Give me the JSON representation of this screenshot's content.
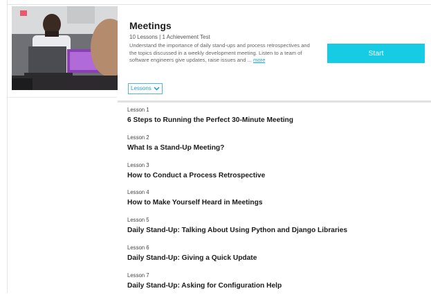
{
  "course": {
    "title": "Meetings",
    "meta": "10 Lessons | 1 Achievement Test",
    "description": "Understand the importance of daily stand-ups and process retrospectives and the topics discussed in a weekly development meeting. Listen to a team of software engineers give updates, raise issues and ...",
    "more_label": "more",
    "start_label": "Start",
    "lessons_toggle_label": "Lessons",
    "toggle_icon": "chevron-down-icon"
  },
  "colors": {
    "accent": "#16cbe4",
    "link": "#16a9c9"
  },
  "lessons": [
    {
      "number": "Lesson 1",
      "title": "6 Steps to Running the Perfect 30-Minute Meeting"
    },
    {
      "number": "Lesson 2",
      "title": "What Is a Stand-Up Meeting?"
    },
    {
      "number": "Lesson 3",
      "title": "How to Conduct a Process Retrospective"
    },
    {
      "number": "Lesson 4",
      "title": "How to Make Yourself Heard in Meetings"
    },
    {
      "number": "Lesson 5",
      "title": "Daily Stand-Up: Talking About Using Python and Django Libraries"
    },
    {
      "number": "Lesson 6",
      "title": "Daily Stand-Up: Giving a Quick Update"
    },
    {
      "number": "Lesson 7",
      "title": "Daily Stand-Up: Asking for Configuration Help"
    }
  ]
}
